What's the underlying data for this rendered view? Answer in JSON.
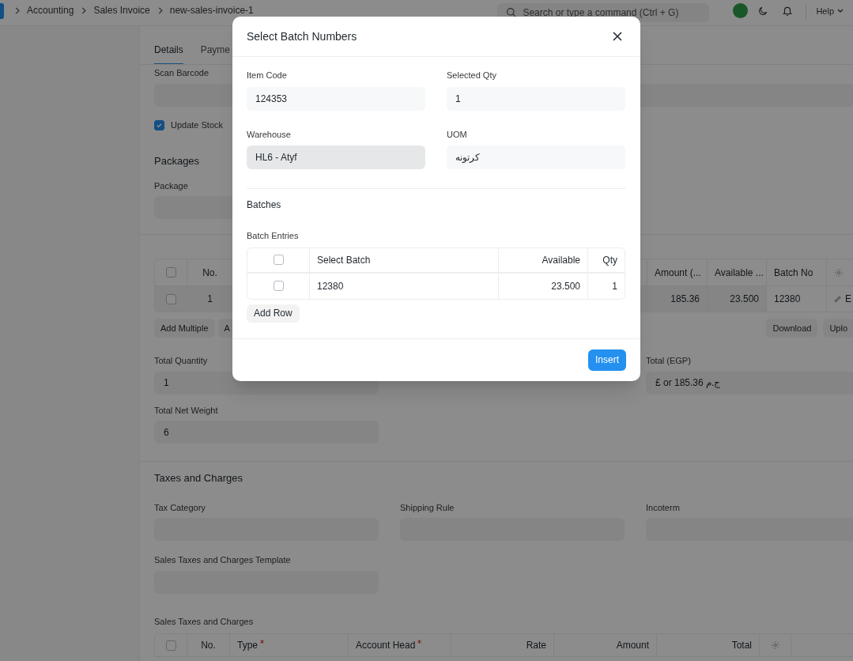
{
  "navbar": {
    "breadcrumbs": [
      "Accounting",
      "Sales Invoice",
      "new-sales-invoice-1"
    ],
    "search": {
      "placeholder": "Search or type a command (Ctrl + G)"
    },
    "help": "Help"
  },
  "form": {
    "tabs": [
      {
        "label": "Details",
        "selected": true
      },
      {
        "label": "Payme",
        "selected": false
      }
    ],
    "scan_barcode": {
      "label": "Scan Barcode"
    },
    "update_stock": {
      "label": "Update Stock",
      "checked": true
    },
    "packages": {
      "title": "Packages",
      "package_label": "Package"
    },
    "items_table": {
      "select_all_checked": false,
      "columns": [
        "No.",
        "Amount (...",
        "Available ...",
        "Batch No"
      ],
      "row": {
        "checked": false,
        "no": "1",
        "amount": "185.36",
        "available": "23.500",
        "batch_no": "12380",
        "edit": "E"
      }
    },
    "items_buttons": [
      "Add Multiple",
      "A",
      "Download",
      "Uplo"
    ],
    "totals": [
      {
        "label": "Total Quantity",
        "value": "1"
      },
      {
        "label": "Total (EGP)",
        "value": "£ or 185.36 ج.م"
      },
      {
        "label": "Total Net Weight",
        "value": "6"
      }
    ],
    "taxes": {
      "title": "Taxes and Charges",
      "fields": [
        {
          "label": "Tax Category"
        },
        {
          "label": "Shipping Rule"
        },
        {
          "label": "Incoterm"
        },
        {
          "label": "Sales Taxes and Charges Template"
        }
      ],
      "table_label": "Sales Taxes and Charges",
      "select_all_checked": false,
      "columns": [
        {
          "label": "No.",
          "required": false
        },
        {
          "label": "Type",
          "required": true
        },
        {
          "label": "Account Head",
          "required": true
        },
        {
          "label": "Rate",
          "required": false
        },
        {
          "label": "Amount",
          "required": false
        },
        {
          "label": "Total",
          "required": false
        }
      ]
    }
  },
  "dialog": {
    "title": "Select Batch Numbers",
    "fields": [
      {
        "label": "Item Code",
        "value": "124353",
        "read_only": false
      },
      {
        "label": "Selected Qty",
        "value": "1",
        "read_only": false
      },
      {
        "label": "Warehouse",
        "value": "HL6 - Atyf",
        "read_only": true
      },
      {
        "label": "UOM",
        "value": "كرتونه",
        "read_only": false
      }
    ],
    "section": "Batches",
    "table_label": "Batch Entries",
    "select_all_checked": false,
    "columns": [
      "Select Batch",
      "Available",
      "Qty"
    ],
    "rows": [
      {
        "checked": false,
        "batch": "12380",
        "available": "23.500",
        "qty": "1"
      }
    ],
    "add_row": "Add Row",
    "primary": "Insert"
  }
}
